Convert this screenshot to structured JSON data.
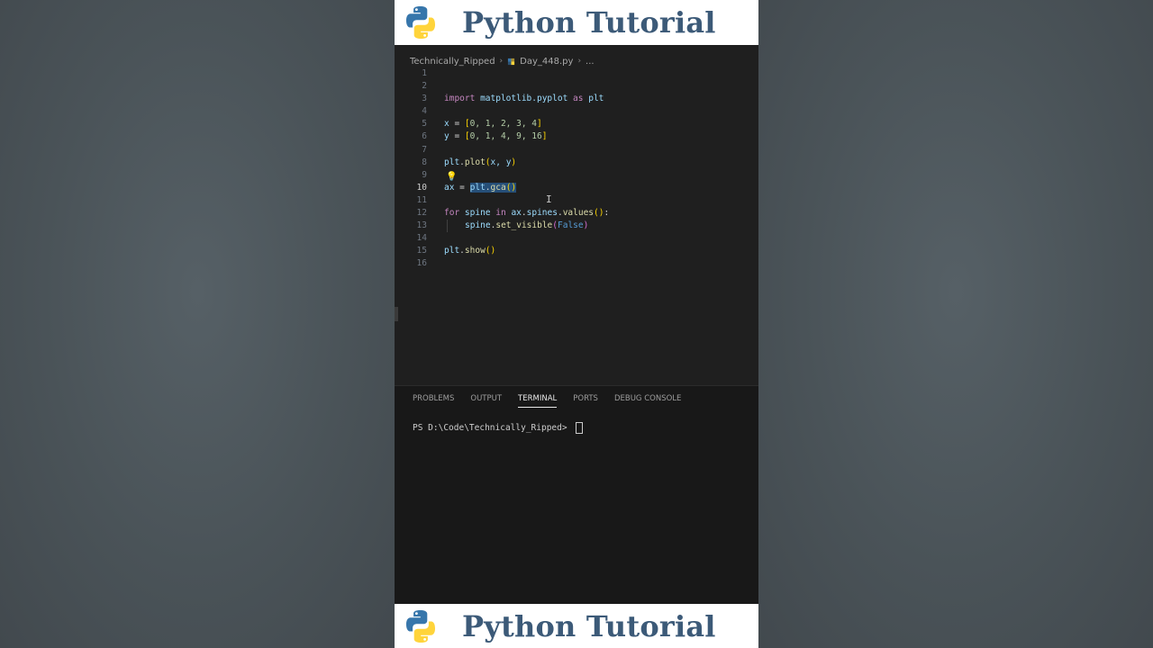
{
  "banner": {
    "title": "Python Tutorial"
  },
  "breadcrumb": {
    "folder": "Technically_Ripped",
    "file": "Day_448.py",
    "more": "..."
  },
  "code": {
    "active_line": "10",
    "lines": [
      "1",
      "2",
      "3",
      "4",
      "5",
      "6",
      "7",
      "8",
      "9",
      "10",
      "11",
      "12",
      "13",
      "14",
      "15",
      "16"
    ],
    "l3": {
      "import": "import",
      "module": "matplotlib.pyplot",
      "as": "as",
      "alias": "plt"
    },
    "l5": {
      "var": "x",
      "eq": " = ",
      "open": "[",
      "vals": "0, 1, 2, 3, 4",
      "close": "]"
    },
    "l6": {
      "var": "y",
      "eq": " = ",
      "open": "[",
      "vals": "0, 1, 4, 9, 16",
      "close": "]"
    },
    "l8": {
      "obj": "plt",
      "fn": "plot",
      "open": "(",
      "args": "x, y",
      "close": ")"
    },
    "l10": {
      "var": "ax",
      "eq": " = ",
      "obj": "plt",
      "fn": "gca",
      "parens": "()"
    },
    "l12": {
      "for": "for",
      "var": "spine",
      "in": "in",
      "obj": "ax",
      "attr": "spines",
      "fn": "values",
      "parens": "()",
      "colon": ":"
    },
    "l13": {
      "obj": "spine",
      "fn": "set_visible",
      "open": "(",
      "arg": "False",
      "close": ")"
    },
    "l15": {
      "obj": "plt",
      "fn": "show",
      "parens": "()"
    }
  },
  "panel": {
    "tabs": [
      "PROBLEMS",
      "OUTPUT",
      "TERMINAL",
      "PORTS",
      "DEBUG CONSOLE"
    ],
    "active_tab": "TERMINAL",
    "prompt": "PS D:\\Code\\Technically_Ripped> "
  },
  "colors": {
    "banner_text": "#3c5a78",
    "python_blue": "#3776ab",
    "python_yellow": "#ffd43b",
    "selection": "#264f78"
  }
}
